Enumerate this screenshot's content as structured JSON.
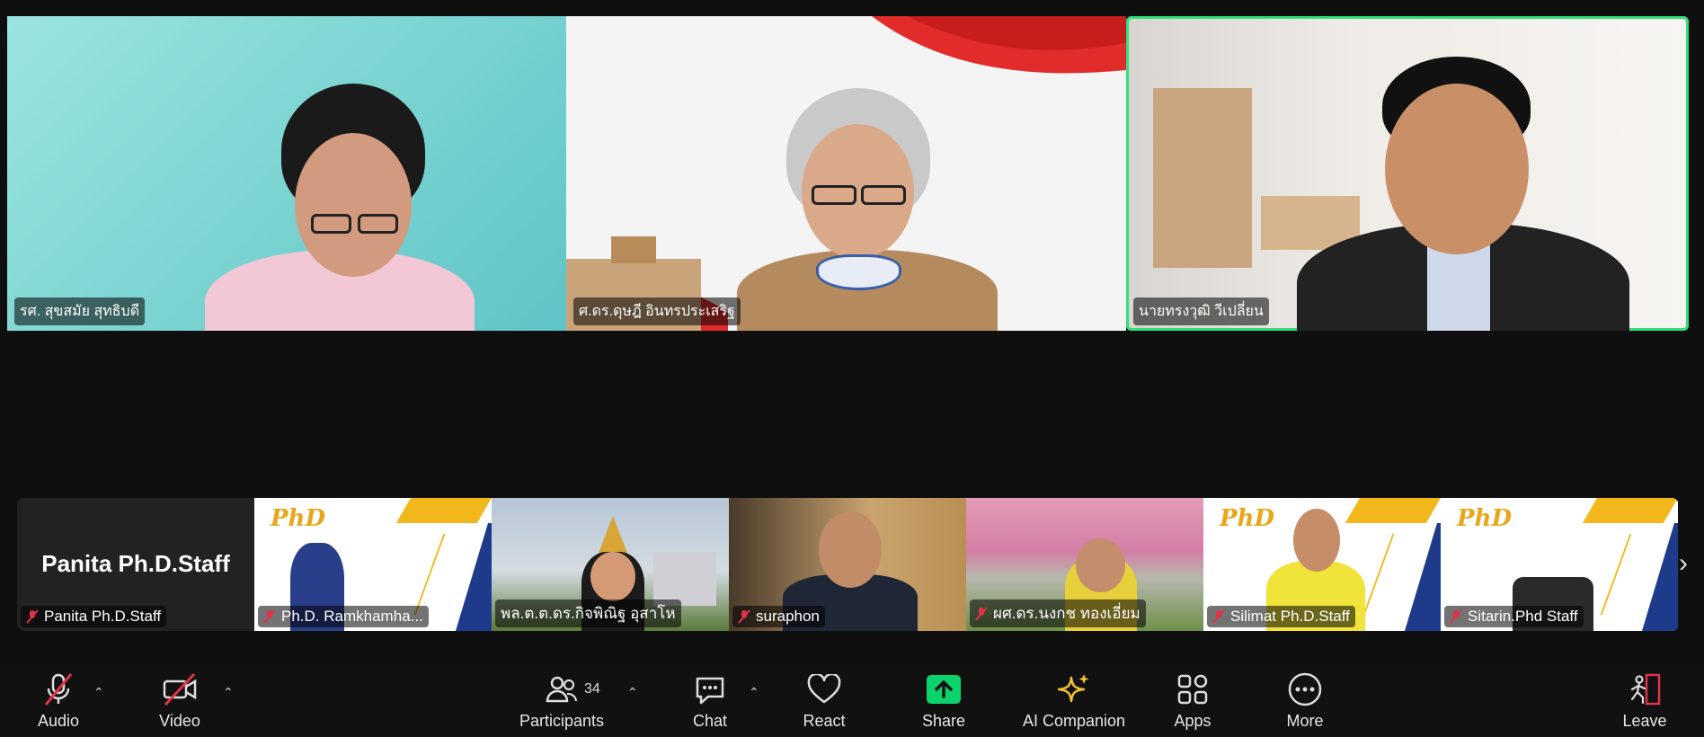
{
  "main_tiles": [
    {
      "name": "รศ. สุขสมัย สุทธิบดี"
    },
    {
      "name": "ศ.ดร.ดุษฎี อินทรประเสริฐ"
    },
    {
      "name": "นายทรงวุฒิ วีเปลี่ยน"
    }
  ],
  "thumbnails": [
    {
      "display_name": "Panita Ph.D.Staff",
      "name": "Panita Ph.D.Staff"
    },
    {
      "name": "Ph.D. Ramkhamha..."
    },
    {
      "name": "พล.ต.ต.ดร.กิจพิณิฐ อุสาโห"
    },
    {
      "name": "suraphon"
    },
    {
      "name": "ผศ.ดร.นงกช ทองเอี่ยม"
    },
    {
      "name": "Silimat Ph.D.Staff"
    },
    {
      "name": "Sitarin.Phd Staff"
    }
  ],
  "phd_logo": "PhD",
  "toolbar": {
    "audio": "Audio",
    "video": "Video",
    "participants": "Participants",
    "participants_count": "34",
    "chat": "Chat",
    "react": "React",
    "share": "Share",
    "ai_companion": "AI Companion",
    "apps": "Apps",
    "more": "More",
    "leave": "Leave"
  },
  "icons": {
    "audio": "microphone-muted-icon",
    "video": "camera-off-icon",
    "participants": "people-icon",
    "chat": "chat-bubble-icon",
    "react": "heart-icon",
    "share": "share-arrow-icon",
    "ai_companion": "sparkle-icon",
    "apps": "apps-grid-icon",
    "more": "ellipsis-icon",
    "leave": "exit-door-icon"
  },
  "colors": {
    "active_speaker_border": "#2fe07b",
    "muted_red": "#e0334a",
    "share_green": "#0bd36b",
    "ai_gold": "#f2c230"
  }
}
